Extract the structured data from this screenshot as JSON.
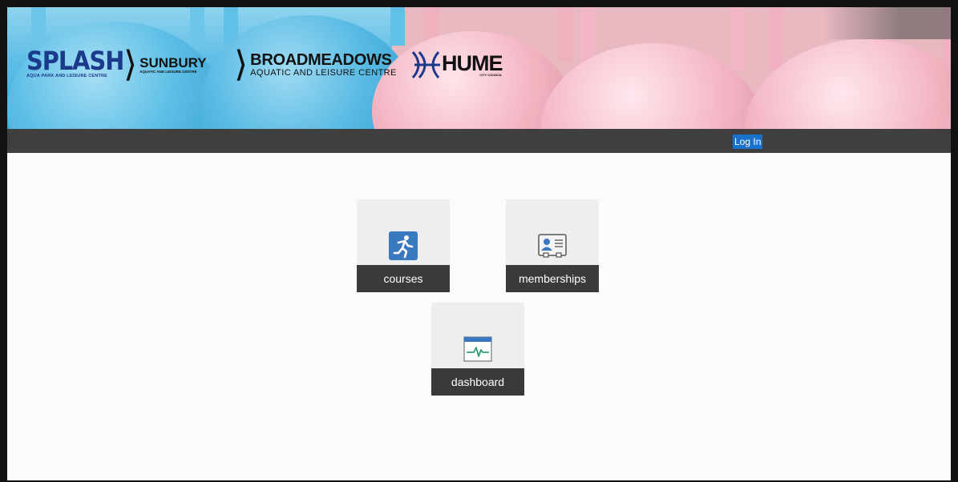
{
  "banner": {
    "logos": {
      "splash": {
        "title": "SPLASH",
        "subtitle": "AQUA PARK AND LEISURE CENTRE"
      },
      "sunbury": {
        "title": "SUNBURY",
        "subtitle": "AQUATIC AND LEISURE CENTRE"
      },
      "broadmeadows": {
        "title": "BROADMEADOWS",
        "subtitle": "AQUATIC AND LEISURE CENTRE"
      },
      "hume": {
        "title": "HUME",
        "subtitle": "CITY COUNCIL"
      }
    }
  },
  "navbar": {
    "login_label": "Log In"
  },
  "tiles": [
    {
      "label": "courses",
      "icon": "runner-icon"
    },
    {
      "label": "memberships",
      "icon": "id-card-icon"
    },
    {
      "label": "dashboard",
      "icon": "heartbeat-monitor-icon"
    }
  ],
  "colors": {
    "navbar": "#3f3f3f",
    "login_button": "#1a72cc",
    "tile_background": "#eeeeee",
    "tile_caption": "#3a3a3a",
    "icon_blue": "#3a78c0"
  }
}
